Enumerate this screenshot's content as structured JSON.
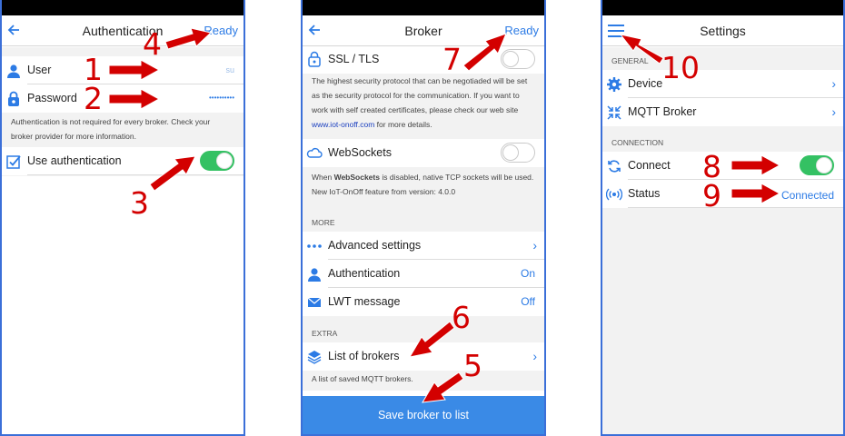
{
  "auth": {
    "title": "Authentication",
    "ready": "Ready",
    "user_label": "User",
    "user_value": "su                 ",
    "password_label": "Password",
    "password_value": "••••••••••",
    "note_line1": "Authentication is not required for every broker. Check your",
    "note_line2": "broker provider for more information.",
    "use_auth_label": "Use authentication",
    "use_auth_on": true
  },
  "broker": {
    "title": "Broker",
    "ready": "Ready",
    "ssl_label": "SSL / TLS",
    "ssl_note1": "The highest security protocol that can be negotiaded will be set",
    "ssl_note2": "as the security protocol for the communication. If you want to",
    "ssl_note3": "work with self created certificates, please check our web site",
    "ssl_link": "www.iot-onoff.com",
    "ssl_note4": " for more details.",
    "ws_label": "WebSockets",
    "ws_note1_pre": "When ",
    "ws_note1_bold": "WebSockets",
    "ws_note1_post": " is disabled, native TCP sockets will be used.",
    "ws_note2": "New IoT-OnOff feature from version: 4.0.0",
    "more_section": "MORE",
    "advanced_label": "Advanced settings",
    "auth_label": "Authentication",
    "auth_value": "On",
    "lwt_label": "LWT message",
    "lwt_value": "Off",
    "extra_section": "EXTRA",
    "list_label": "List of brokers",
    "list_note": "A list of saved MQTT brokers.",
    "save_label": "Save broker to list"
  },
  "settings": {
    "title": "Settings",
    "general_section": "GENERAL",
    "device_label": "Device",
    "mqtt_label": "MQTT Broker",
    "connection_section": "CONNECTION",
    "connect_label": "Connect",
    "connect_on": true,
    "status_label": "Status",
    "status_value": "Connected"
  },
  "callouts": [
    "1",
    "2",
    "3",
    "4",
    "5",
    "6",
    "7",
    "8",
    "9",
    "10"
  ],
  "colors": {
    "accent": "#2c7be5",
    "toggle_on": "#34c163",
    "annotation": "#d30000",
    "connected": "#1e9e3a"
  }
}
